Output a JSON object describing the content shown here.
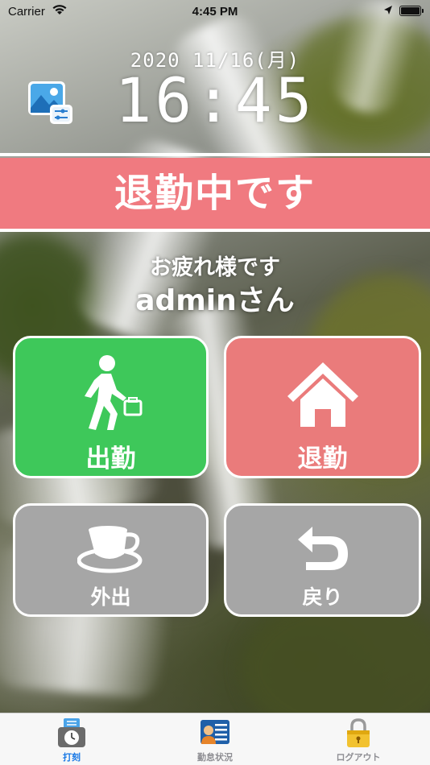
{
  "status_bar": {
    "carrier": "Carrier",
    "time": "4:45 PM"
  },
  "clock": {
    "date": "2020 11/16(月)",
    "time": "16:45"
  },
  "status_banner": "退勤中です",
  "greeting": "お疲れ様です",
  "user_name": "adminさん",
  "buttons": {
    "clock_in": "出勤",
    "clock_out": "退勤",
    "go_out": "外出",
    "return": "戻り"
  },
  "colors": {
    "clock_in": "#3ec85a",
    "clock_out": "#ea7b7b",
    "banner": "#f07a80",
    "inactive_button": "#a6a6a6",
    "tab_active": "#1677e5"
  },
  "tabs": [
    {
      "label": "打刻",
      "icon": "timecard-clock-icon",
      "active": true
    },
    {
      "label": "勤怠状況",
      "icon": "employee-list-icon",
      "active": false
    },
    {
      "label": "ログアウト",
      "icon": "padlock-icon",
      "active": false
    }
  ]
}
